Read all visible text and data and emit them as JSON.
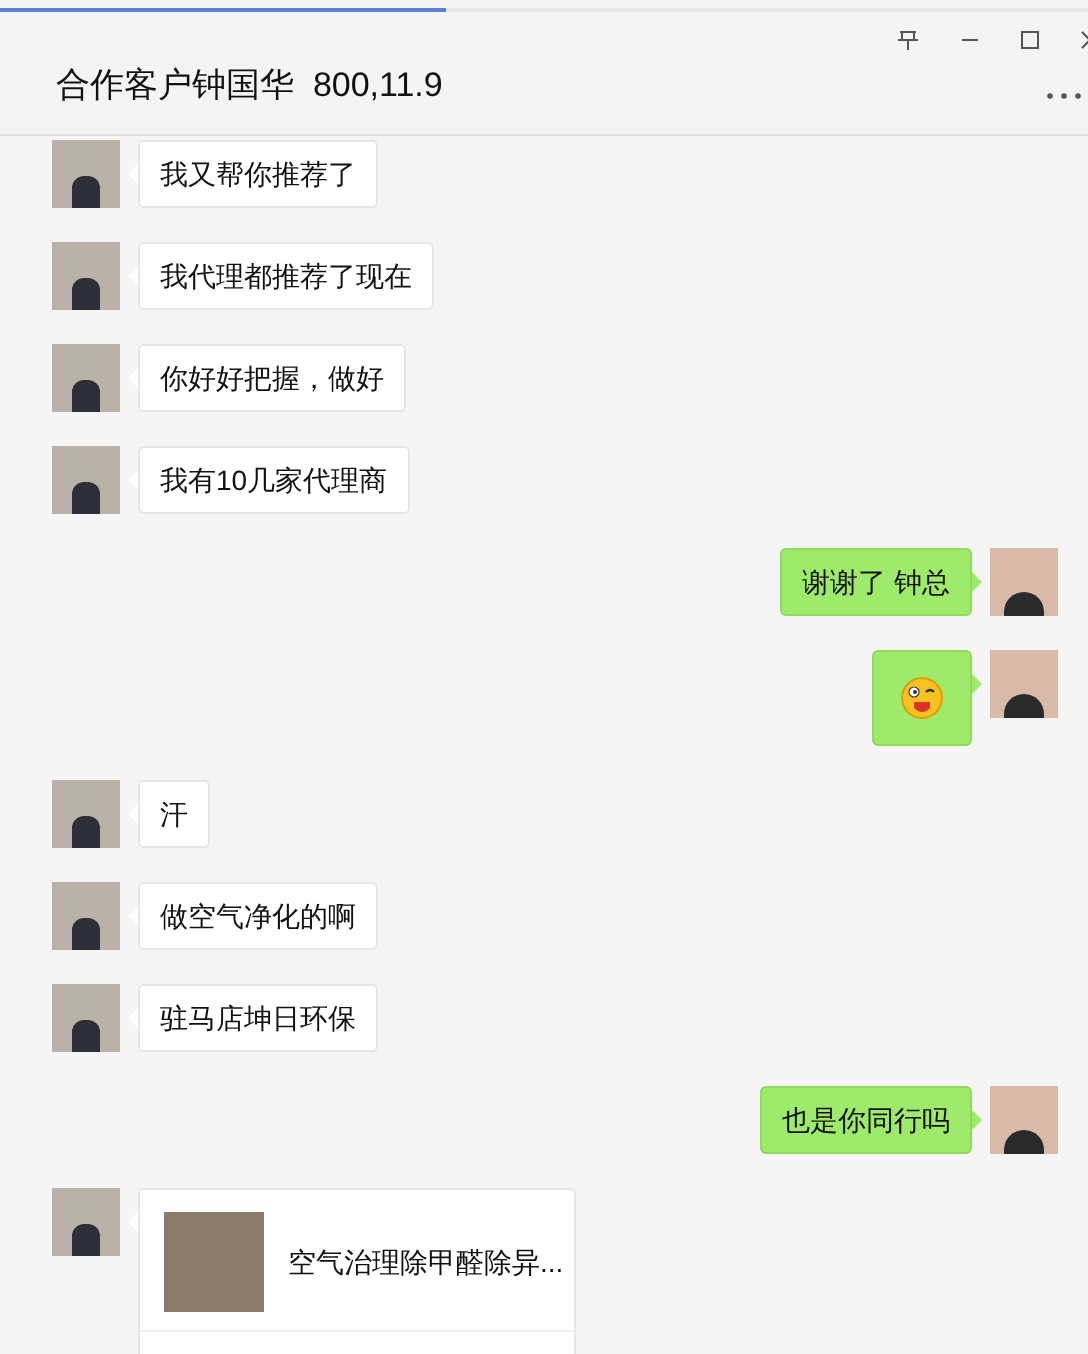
{
  "window": {
    "title": "合作客户钟国华  800,11.9"
  },
  "loading_bar": {
    "level": 0.41
  },
  "messages": [
    {
      "outgoing": false,
      "kind": "text",
      "text": "我又帮你推荐了"
    },
    {
      "outgoing": false,
      "kind": "text",
      "text": "我代理都推荐了现在"
    },
    {
      "outgoing": false,
      "kind": "text",
      "text": "你好好把握，做好"
    },
    {
      "outgoing": false,
      "kind": "text",
      "text": "我有10几家代理商"
    },
    {
      "outgoing": true,
      "kind": "text",
      "text": "谢谢了  钟总"
    },
    {
      "outgoing": true,
      "kind": "emoji"
    },
    {
      "outgoing": false,
      "kind": "text",
      "text": "汗"
    },
    {
      "outgoing": false,
      "kind": "text",
      "text": "做空气净化的啊"
    },
    {
      "outgoing": false,
      "kind": "text",
      "text": "驻马店坤日环保"
    },
    {
      "outgoing": true,
      "kind": "text",
      "text": "也是你同行吗"
    },
    {
      "outgoing": false,
      "kind": "card",
      "text": "空气治理除甲醛除异..."
    }
  ]
}
